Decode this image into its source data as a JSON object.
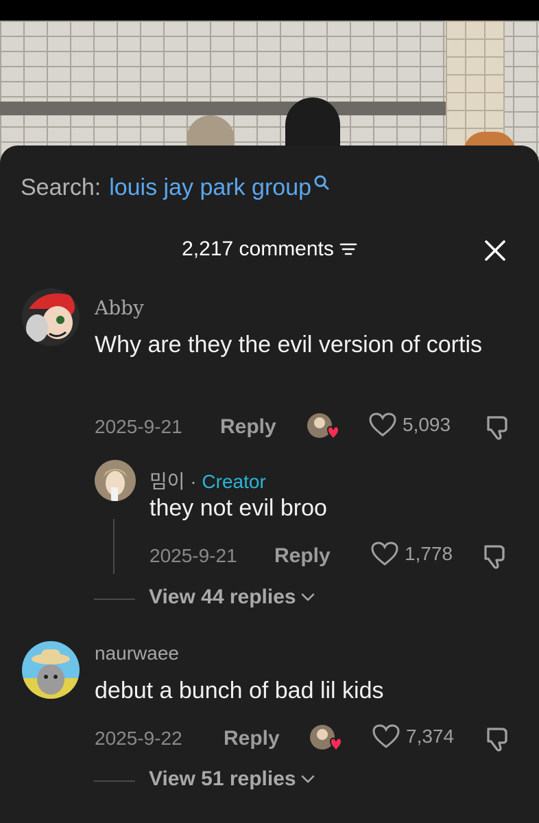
{
  "search": {
    "prefix": "Search:",
    "query": "louis jay park group"
  },
  "header": {
    "comment_count": "2,217 comments"
  },
  "comments": [
    {
      "username": "Abby",
      "text": "Why are they the evil version of cortis",
      "date": "2025-9-21",
      "reply_label": "Reply",
      "likes": "5,093",
      "reply": {
        "username": "밈이",
        "separator": "·",
        "badge": "Creator",
        "text": "they not evil broo",
        "date": "2025-9-21",
        "reply_label": "Reply",
        "likes": "1,778"
      },
      "view_replies": "View 44 replies"
    },
    {
      "username": "naurwaee",
      "text": "debut a bunch of bad lil kids",
      "date": "2025-9-22",
      "reply_label": "Reply",
      "likes": "7,374",
      "view_replies": "View 51 replies"
    }
  ],
  "colors": {
    "sheet_bg": "#1f1f1f",
    "link_blue": "#5ba7ef",
    "creator_cyan": "#29b6d8",
    "heart_red": "#fe2c55"
  }
}
